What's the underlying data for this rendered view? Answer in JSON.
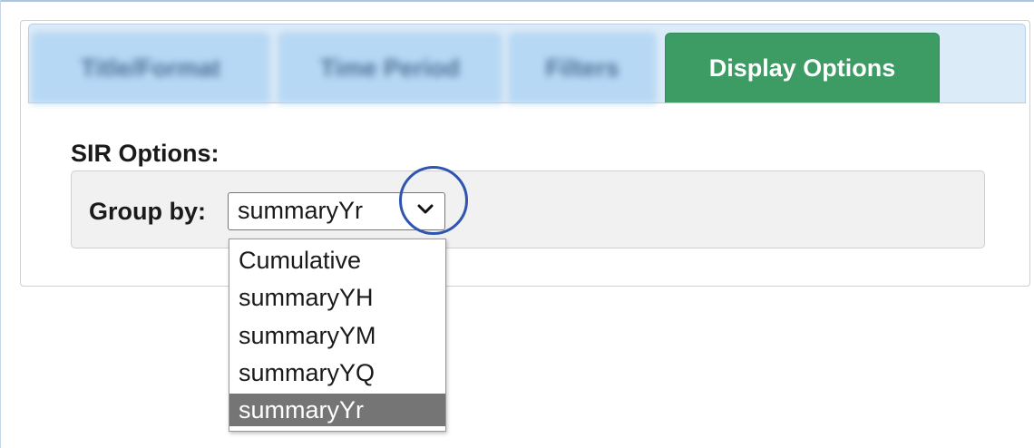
{
  "tabs": [
    {
      "label": "Title/Format",
      "state": "blurred"
    },
    {
      "label": "Time Period",
      "state": "blurred"
    },
    {
      "label": "Filters",
      "state": "blurred"
    },
    {
      "label": "Display Options",
      "state": "active"
    }
  ],
  "section": {
    "title": "SIR Options:",
    "group_by_label": "Group by:",
    "group_by_selected": "summaryYr"
  },
  "dropdown": {
    "options": [
      "Cumulative",
      "summaryYH",
      "summaryYM",
      "summaryYQ",
      "summaryYr"
    ],
    "highlighted_index": 4
  },
  "icons": {
    "select_arrow": "chevron-down-icon",
    "annotation": "highlight-circle"
  },
  "colors": {
    "active_tab": "#3c9c63",
    "tab_bar": "#dcebf8",
    "selected_option": "#757575",
    "annotation_circle": "#2f55b0"
  }
}
